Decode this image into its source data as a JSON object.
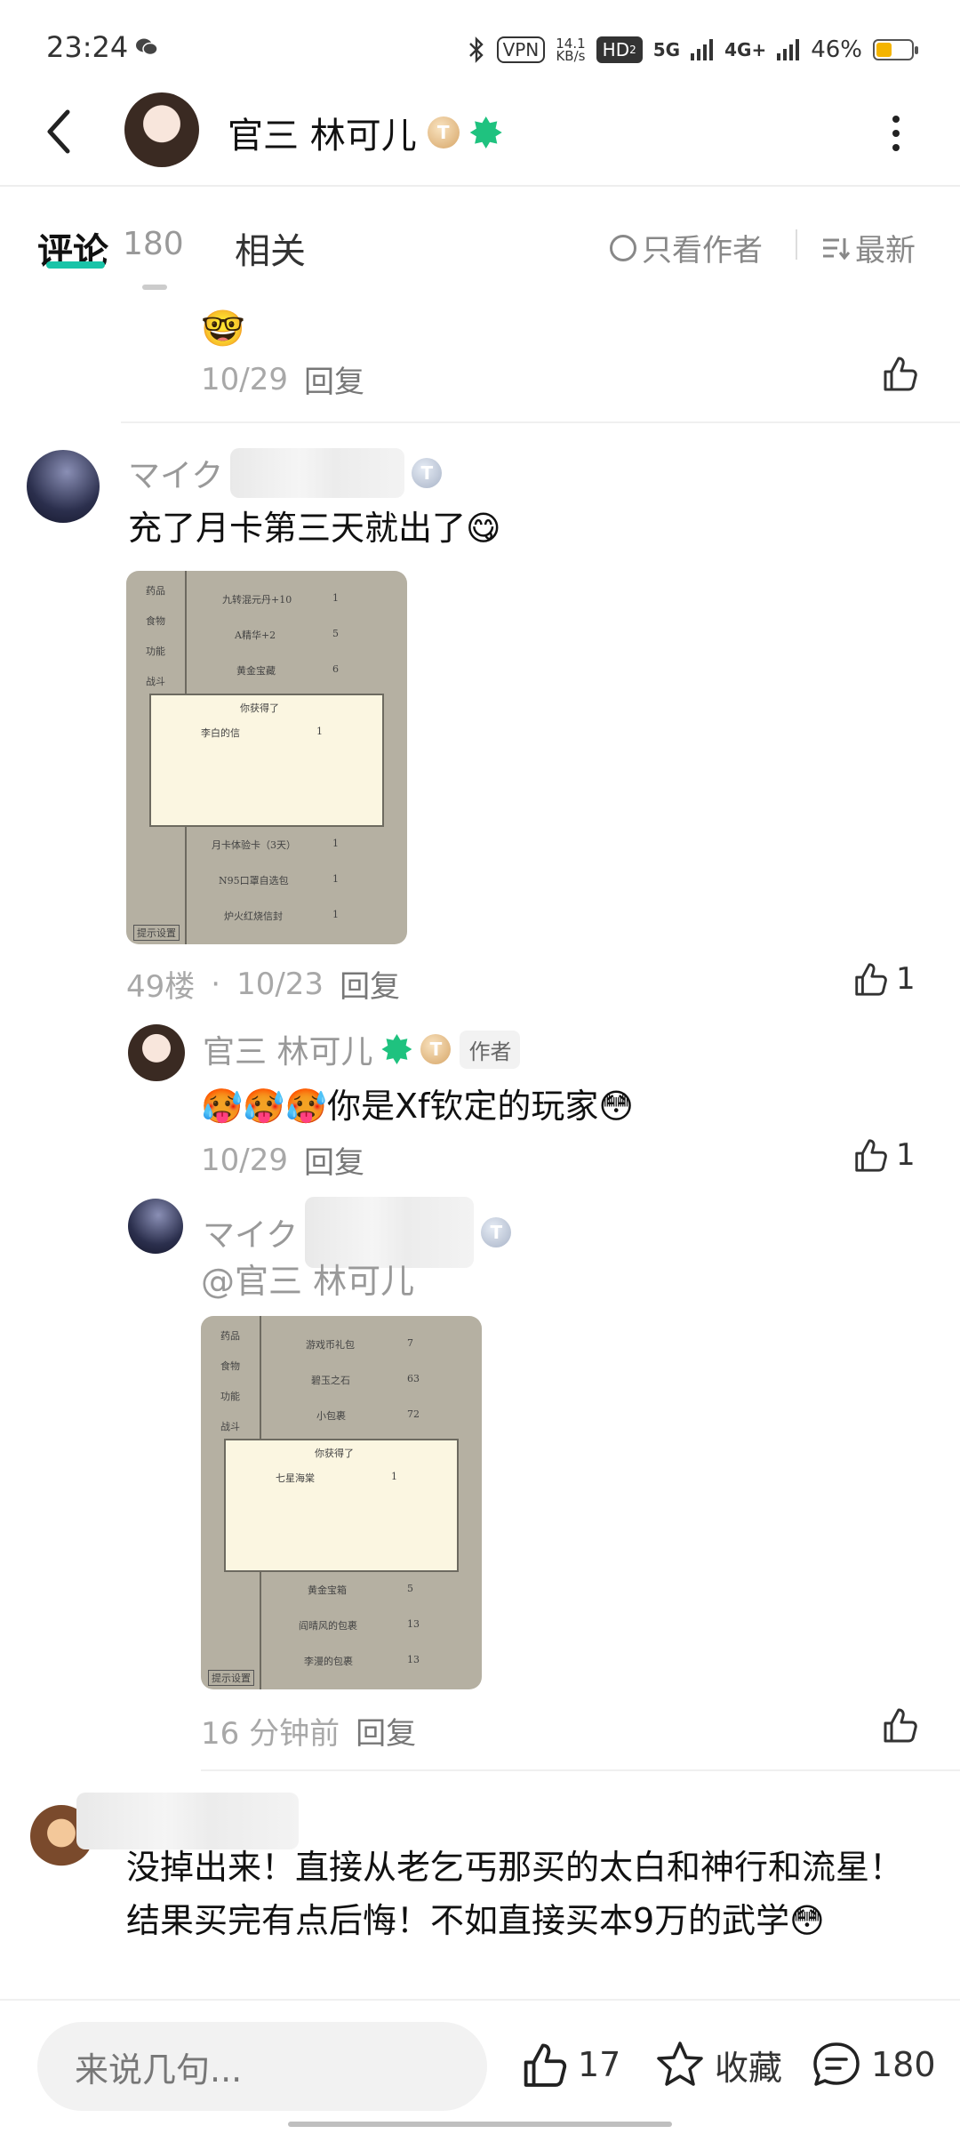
{
  "status_bar": {
    "time": "23:24",
    "net_speed_value": "14.1",
    "net_speed_unit": "KB/s",
    "vpn": "VPN",
    "hd": "HD",
    "hd_sub": "2",
    "net_5g": "5G",
    "net_4g": "4G+",
    "battery": "46%"
  },
  "header": {
    "title": "官三 林可儿",
    "level_badge": "T"
  },
  "tabs": {
    "comments_label": "评论",
    "comments_count": "180",
    "related_label": "相关",
    "author_only": "只看作者",
    "sort": "最新"
  },
  "top_item": {
    "date": "10/29",
    "reply": "回复"
  },
  "comment1": {
    "user": "マイク",
    "text": "充了月卡第三天就出了😋",
    "floor": "49楼",
    "dot": "·",
    "date": "10/23",
    "reply": "回复",
    "likes": "1",
    "image": {
      "side_items": [
        "药品",
        "食物",
        "功能",
        "战斗"
      ],
      "rows_top": [
        {
          "name": "九转混元丹+10",
          "qty": "1"
        },
        {
          "name": "A精华+2",
          "qty": "5"
        },
        {
          "name": "黄金宝藏",
          "qty": "6"
        }
      ],
      "popup_title": "你获得了",
      "popup_item": "李白的信",
      "popup_qty": "1",
      "rows_bottom": [
        {
          "name": "月卡体验卡（3天）",
          "qty": "1"
        },
        {
          "name": "N95口罩自选包",
          "qty": "1"
        },
        {
          "name": "炉火红烧信封",
          "qty": "1"
        }
      ],
      "footer": "提示设置"
    }
  },
  "reply1": {
    "user": "官三 林可儿",
    "level_badge": "T",
    "author_tag": "作者",
    "text": "🥵🥵🥵你是Xf钦定的玩家😳",
    "date": "10/29",
    "reply": "回复",
    "likes": "1"
  },
  "reply2": {
    "user": "マイク",
    "mention": "@官三 林可儿",
    "time": "16 分钟前",
    "reply": "回复",
    "image": {
      "side_items": [
        "药品",
        "食物",
        "功能",
        "战斗"
      ],
      "rows_top": [
        {
          "name": "游戏币礼包",
          "qty": "7"
        },
        {
          "name": "碧玉之石",
          "qty": "63"
        },
        {
          "name": "小包裹",
          "qty": "72"
        }
      ],
      "popup_title": "你获得了",
      "popup_item": "七星海棠",
      "popup_qty": "1",
      "rows_bottom": [
        {
          "name": "黄金宝箱",
          "qty": "5"
        },
        {
          "name": "阎晴风的包裹",
          "qty": "13"
        },
        {
          "name": "李漫的包裹",
          "qty": "13"
        }
      ],
      "footer": "提示设置"
    }
  },
  "comment2": {
    "text": "没掉出来！直接从老乞丐那买的太白和神行和流星！结果买完有点后悔！不如直接买本9万的武学😳"
  },
  "bottom_bar": {
    "input_placeholder": "来说几句...",
    "likes": "17",
    "favorite": "收藏",
    "comments": "180"
  },
  "colors": {
    "accent": "#19c4a8",
    "badge_green": "#1fc27f",
    "badge_gold": "#d6a567"
  }
}
